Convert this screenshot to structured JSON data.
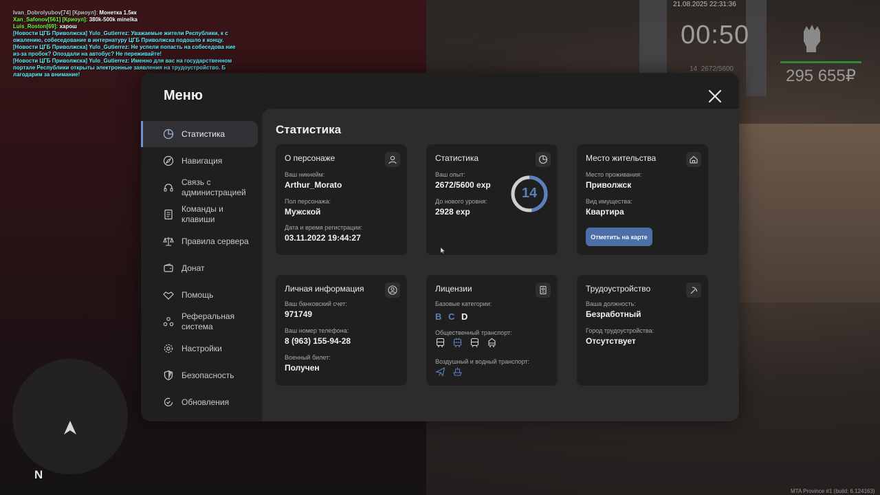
{
  "chat": [
    {
      "name": "Ivan_Dobrolyubov[74] [Криоул]:",
      "text": " Монетка 1.5кк",
      "cls": "c-gray"
    },
    {
      "name": "Xan_Safonov[561] [Криоул]:",
      "text": " 380k-500k minelka",
      "cls": "c-lime"
    },
    {
      "name": "Luis_Roston[69]:",
      "text": " харош",
      "cls": "c-lime"
    },
    {
      "name": "[Новости ЦГБ Приволжска] Yulo_Gutierrez:",
      "text": " Уважаемые жители Республики, к с ожалению, собеседование в интернатуру ЦГБ Приволжска подошло к концу.",
      "cls": "c-cyan"
    },
    {
      "name": "[Новости ЦГБ Приволжска] Yulo_Gutierrez:",
      "text": " Не успели попасть на собеседова ние из-за пробок? Опоздали на автобус? Не переживайте!",
      "cls": "c-cyan"
    },
    {
      "name": "[Новости ЦГБ Приволжска] Yulo_Gutierrez:",
      "text": " Именно для вас на государственном портале Республики открыты электронные заявления на трудоустройство. Б лагодарим за внимание!",
      "cls": "c-cyan"
    }
  ],
  "hud": {
    "datetime": "21.08.2025 22:31:36",
    "timer": "00:50",
    "level": "14",
    "exp": "2672/5600",
    "money": "295 655₽",
    "build": "MTA Province #1 (build: 6.124163)",
    "compass": "N"
  },
  "menu": {
    "title": "Меню",
    "close_icon": "close-icon",
    "sidebar": [
      {
        "label": "Статистика",
        "icon": "pie-chart-icon",
        "active": true
      },
      {
        "label": "Навигация",
        "icon": "compass-icon"
      },
      {
        "label": "Связь с администрацией",
        "icon": "headset-icon"
      },
      {
        "label": "Команды и клавиши",
        "icon": "document-icon"
      },
      {
        "label": "Правила сервера",
        "icon": "scales-icon"
      },
      {
        "label": "Донат",
        "icon": "wallet-icon"
      },
      {
        "label": "Помощь",
        "icon": "handshake-icon"
      },
      {
        "label": "Реферальная система",
        "icon": "people-network-icon"
      },
      {
        "label": "Настройки",
        "icon": "gear-icon"
      },
      {
        "label": "Безопасность",
        "icon": "shield-icon"
      },
      {
        "label": "Обновления",
        "icon": "refresh-check-icon"
      }
    ]
  },
  "stats": {
    "title": "Статистика",
    "character": {
      "title": "О персонаже",
      "nick_label": "Ваш никнейм:",
      "nick": "Arthur_Morato",
      "gender_label": "Пол персонажа:",
      "gender": "Мужской",
      "reg_label": "Дата и время регистрации:",
      "reg": "03.11.2022 19:44:27"
    },
    "statistics": {
      "title": "Статистика",
      "exp_label": "Ваш опыт:",
      "exp": "2672/5600 exp",
      "next_label": "До нового уровня:",
      "next": "2928 exp",
      "level": "14",
      "progress": 0.477
    },
    "residence": {
      "title": "Место жительства",
      "city_label": "Место проживания:",
      "city": "Приволжск",
      "prop_label": "Вид имущества:",
      "prop": "Квартира",
      "button": "Отметить на карте"
    },
    "personal": {
      "title": "Личная информация",
      "bank_label": "Ваш банковский счет:",
      "bank": "971749",
      "phone_label": "Ваш номер телефона:",
      "phone": "8 (963) 155-94-28",
      "military_label": "Военный билет:",
      "military": "Получен"
    },
    "licenses": {
      "title": "Лицензии",
      "base_label": "Базовые категории:",
      "cats": [
        "B",
        "C",
        "D"
      ],
      "public_label": "Общественный транспорт:",
      "air_label": "Воздушный и водный транспорт:"
    },
    "employment": {
      "title": "Трудоустройство",
      "post_label": "Ваша должность:",
      "post": "Безработный",
      "city_label": "Город трудоустройства:",
      "city": "Отсутствует"
    }
  },
  "colors": {
    "accent": "#5b7fbe",
    "panel": "#1f1f1f",
    "content": "#2c2c2c",
    "muted_cat": "#5b7fbe",
    "active_cat": "#f2f2f2"
  }
}
